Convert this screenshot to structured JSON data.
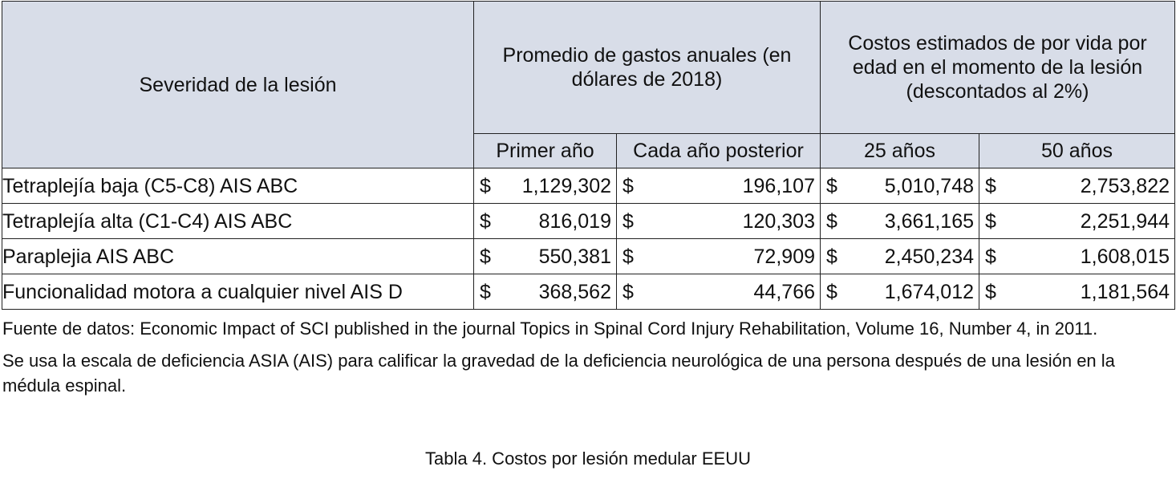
{
  "table": {
    "header": {
      "severity": "Severidad de la lesión",
      "annual_group": "Promedio de gastos anuales (en dólares de 2018)",
      "lifetime_group": "Costos estimados de por vida por edad en el momento de la lesión (descontados al 2%)",
      "first_year": "Primer año",
      "each_year": "Cada año posterior",
      "age_25": "25 años",
      "age_50": "50 años"
    },
    "currency_symbol": "$",
    "rows": [
      {
        "label": "Tetraplejía baja (C5-C8) AIS ABC",
        "first_year": "1,129,302",
        "each_year": "196,107",
        "age_25": "5,010,748",
        "age_50": "2,753,822"
      },
      {
        "label": "Tetraplejía alta (C1-C4) AIS ABC",
        "first_year": "816,019",
        "each_year": "120,303",
        "age_25": "3,661,165",
        "age_50": "2,251,944"
      },
      {
        "label": "Paraplejia AIS ABC",
        "first_year": "550,381",
        "each_year": "72,909",
        "age_25": "2,450,234",
        "age_50": "1,608,015"
      },
      {
        "label": "Funcionalidad motora a cualquier nivel AIS D",
        "first_year": "368,562",
        "each_year": "44,766",
        "age_25": "1,674,012",
        "age_50": "1,181,564"
      }
    ]
  },
  "notes": {
    "source": "Fuente de datos: Economic Impact of SCI published in the journal Topics in Spinal Cord Injury Rehabilitation, Volume 16, Number 4, in 2011.",
    "scale": "Se usa la escala de deficiencia ASIA (AIS) para calificar la gravedad de la deficiencia neurológica de una persona después de una lesión en la médula espinal."
  },
  "caption": "Tabla 4. Costos por lesión medular EEUU"
}
